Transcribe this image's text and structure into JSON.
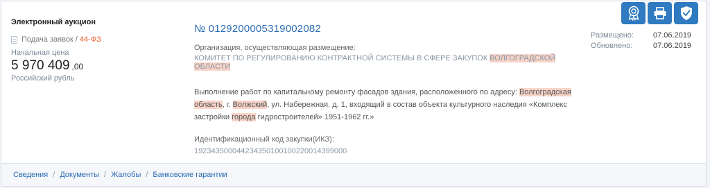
{
  "card": {
    "procedure_type": "Электронный аукцион",
    "stage": "Подача заявок",
    "stage_separator": "/",
    "law": "44-ФЗ",
    "price_label": "Начальная цена",
    "price_main": "5 970 409",
    "price_cents": ",00",
    "currency": "Российский рубль",
    "number": "№ 0129200005319002082",
    "org_label": "Организация, осуществляющая размещение:",
    "org_name_parts": [
      "КОМИТЕТ ПО РЕГУЛИРОВАНИЮ КОНТРАКТНОЙ СИСТЕМЫ В СФЕРЕ ЗАКУПОК ",
      "ВОЛГОГРАДСКОЙ",
      " ",
      "ОБЛАСТИ"
    ],
    "description_parts": [
      "Выполнение работ по капитальному ремонту фасадов здания, расположенного по адресу: ",
      "Волгоградская область",
      ", г. ",
      "Волжский",
      ", ул. Набережная. д. 1, входящий в состав объекта культурного наследия «Комплекс застройки ",
      "города",
      " гидростроителей» 1951-1962 гг.»"
    ],
    "ikz_label": "Идентификационный код закупки(ИКЗ):",
    "ikz": "192343500044234350100100220014399000",
    "dates": {
      "placed_label": "Размещено:",
      "placed_value": "07.06.2019",
      "updated_label": "Обновлено:",
      "updated_value": "07.06.2019"
    },
    "action_icons": [
      "award-icon",
      "printer-icon",
      "shield-check-icon"
    ],
    "accent_color": "#2f7ac1",
    "highlight_color": "#f7d3c7"
  },
  "footer": {
    "links": [
      "Сведения",
      "Документы",
      "Жалобы",
      "Банковские гарантии"
    ],
    "separator": "/"
  }
}
